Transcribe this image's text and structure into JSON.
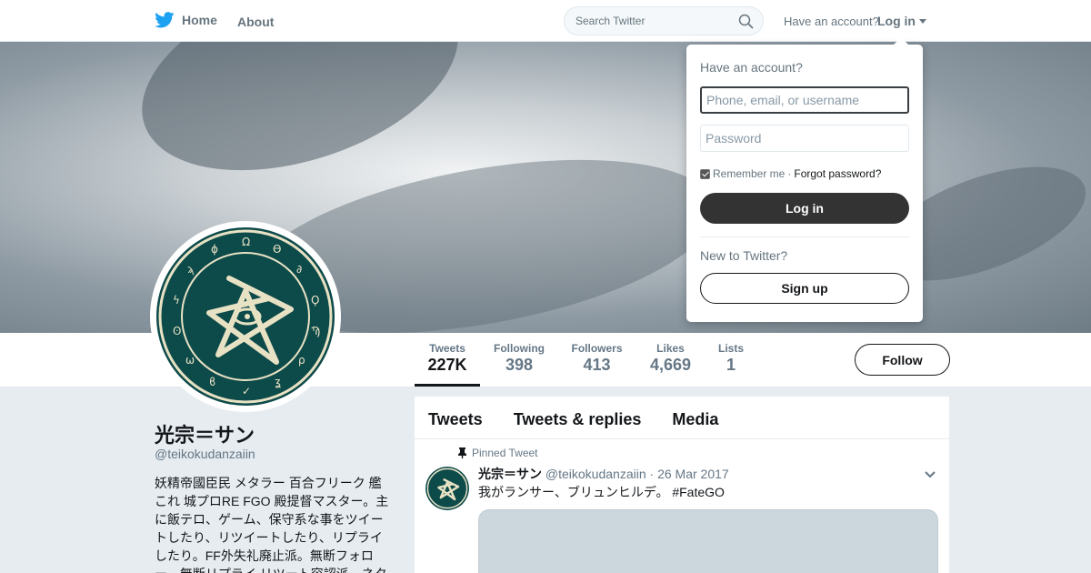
{
  "nav": {
    "home_label": "Home",
    "about_label": "About",
    "search_placeholder": "Search Twitter",
    "have_account_text": "Have an account?",
    "login_label": "Log in"
  },
  "login_dropdown": {
    "title": "Have an account?",
    "username_placeholder": "Phone, email, or username",
    "password_placeholder": "Password",
    "remember_label": "Remember me",
    "separator": "·",
    "forgot_label": "Forgot password?",
    "login_button": "Log in",
    "new_text": "New to Twitter?",
    "signup_button": "Sign up"
  },
  "stats": [
    {
      "label": "Tweets",
      "value": "227K"
    },
    {
      "label": "Following",
      "value": "398"
    },
    {
      "label": "Followers",
      "value": "413"
    },
    {
      "label": "Likes",
      "value": "4,669"
    },
    {
      "label": "Lists",
      "value": "1"
    }
  ],
  "follow_button": "Follow",
  "profile": {
    "name": "光宗＝サン",
    "handle": "@teikokudanzaiin",
    "bio": "妖精帝國臣民 メタラー 百合フリーク 艦これ 城プロRE FGO 殿提督マスター。主に飯テロ、ゲーム、保守系な事をツイートしたり、リツイートしたり、リプライしたり。FF外失礼廃止派。無断フォロー、無断リプライ リツート容認派。ネタ"
  },
  "timeline": {
    "tabs": [
      "Tweets",
      "Tweets & replies",
      "Media"
    ],
    "pinned_label": "Pinned Tweet",
    "tweet": {
      "name": "光宗＝サン",
      "handle": "@teikokudanzaiin",
      "separator": "·",
      "date": "26 Mar 2017",
      "text": "我がランサー、ブリュンヒルデ。 #FateGO"
    }
  },
  "colors": {
    "brand": "#1da1f2",
    "avatar_bg": "#0d4a4a",
    "avatar_ink": "#e8e2c4"
  }
}
